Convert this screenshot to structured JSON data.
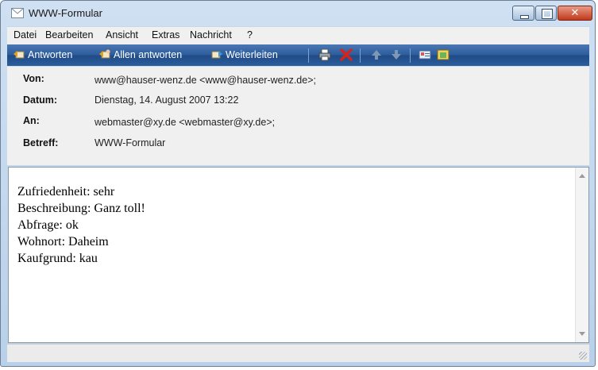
{
  "window": {
    "title": "WWW-Formular"
  },
  "menu": {
    "items": [
      "Datei",
      "Bearbeiten",
      "Ansicht",
      "Extras",
      "Nachricht",
      "?"
    ]
  },
  "toolbar": {
    "reply": "Antworten",
    "reply_all": "Allen antworten",
    "forward": "Weiterleiten"
  },
  "header": {
    "from_label": "Von:",
    "from_value": "www@hauser-wenz.de <www@hauser-wenz.de>;",
    "date_label": "Datum:",
    "date_value": "Dienstag, 14. August 2007 13:22",
    "to_label": "An:",
    "to_value": "webmaster@xy.de <webmaster@xy.de>;",
    "subject_label": "Betreff:",
    "subject_value": "WWW-Formular"
  },
  "body": {
    "lines": [
      "Zufriedenheit: sehr",
      "Beschreibung: Ganz toll!",
      "Abfrage: ok",
      "Wohnort: Daheim",
      "Kaufgrund: kau"
    ]
  },
  "colors": {
    "toolbar": "#2c5c9c",
    "close_button": "#c2391c",
    "delete_icon": "#d8231b"
  },
  "icons": [
    "envelope-icon",
    "reply-icon",
    "reply-all-icon",
    "forward-icon",
    "print-icon",
    "delete-icon",
    "previous-icon",
    "next-icon",
    "addresses-icon",
    "calendar-icon"
  ]
}
